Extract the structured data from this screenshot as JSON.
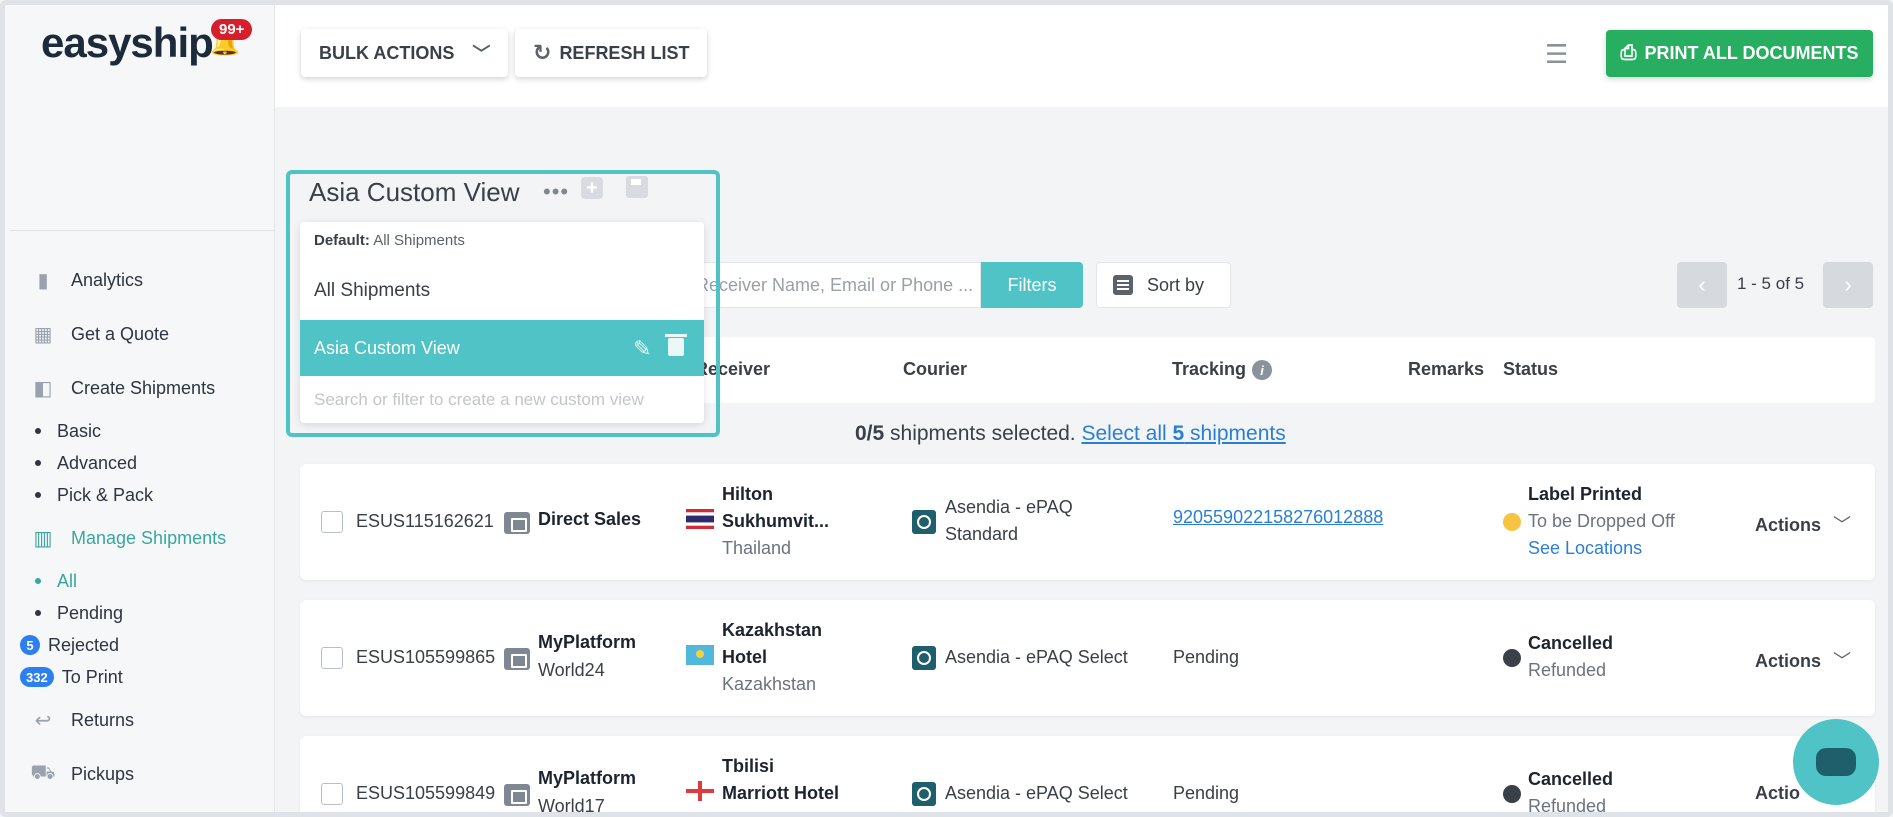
{
  "app": {
    "logo": "easyship",
    "notification_count": "99+"
  },
  "sidebar": {
    "items": [
      {
        "label": "Analytics",
        "icon": "analytics-icon"
      },
      {
        "label": "Get a Quote",
        "icon": "calculator-icon"
      },
      {
        "label": "Create Shipments",
        "icon": "box-icon"
      }
    ],
    "create_sub": [
      "Basic",
      "Advanced",
      "Pick & Pack"
    ],
    "manage": {
      "label": "Manage Shipments",
      "icon": "barcode-icon"
    },
    "manage_sub": [
      {
        "label": "All",
        "count": null,
        "active": true
      },
      {
        "label": "Pending",
        "count": null
      },
      {
        "label": "Rejected",
        "count": "5"
      },
      {
        "label": "To Print",
        "count": "332"
      }
    ],
    "bottom_items": [
      {
        "label": "Returns",
        "icon": "returns-icon"
      },
      {
        "label": "Pickups",
        "icon": "truck-icon"
      }
    ]
  },
  "toolbar": {
    "bulk_actions": "BULK ACTIONS",
    "refresh": "REFRESH LIST",
    "print_all": "PRINT ALL DOCUMENTS"
  },
  "custom_view": {
    "title": "Asia Custom View",
    "menu_dots": "•••",
    "add": "+",
    "dropdown": {
      "default_label": "Default:",
      "default_value": "All Shipments",
      "option_all": "All Shipments",
      "option_active": "Asia Custom View",
      "search_placeholder": "Search or filter to create a new custom view"
    }
  },
  "search": {
    "placeholder": "Receiver Name, Email or Phone ...",
    "filters": "Filters",
    "sort": "Sort by"
  },
  "pager": {
    "text": "1 - 5 of 5",
    "prev": "‹",
    "next": "›"
  },
  "table": {
    "headers": {
      "receiver": "Receiver",
      "courier": "Courier",
      "tracking": "Tracking",
      "remarks": "Remarks",
      "status": "Status"
    },
    "info": "i",
    "selected": {
      "count": "0/5",
      "text": " shipments selected. ",
      "select_all_prefix": "Select all ",
      "select_all_count": "5",
      "select_all_suffix": " shipments"
    },
    "rows": [
      {
        "id": "ESUS115162621",
        "store": "Direct Sales",
        "store_sub": "",
        "receiver_line1": "Hilton",
        "receiver_line2": "Sukhumvit...",
        "country": "Thailand",
        "courier_line1": "Asendia - ePAQ",
        "courier_line2": "Standard",
        "tracking": "920559022158276012888",
        "status_title": "Label Printed",
        "status_sub": "To be Dropped Off",
        "status_link": "See Locations",
        "status_color": "#f6c342",
        "actions": "Actions"
      },
      {
        "id": "ESUS105599865",
        "store": "MyPlatform",
        "store_sub": "World24",
        "receiver_line1": "Kazakhstan",
        "receiver_line2": "Hotel",
        "country": "Kazakhstan",
        "courier_line1": "Asendia - ePAQ Select",
        "courier_line2": "",
        "tracking": "Pending",
        "status_title": "Cancelled",
        "status_sub": "Refunded",
        "status_link": "",
        "status_color": "#3a4048",
        "actions": "Actions"
      },
      {
        "id": "ESUS105599849",
        "store": "MyPlatform",
        "store_sub": "World17",
        "receiver_line1": "Tbilisi",
        "receiver_line2": "Marriott Hotel",
        "country": "",
        "courier_line1": "Asendia - ePAQ Select",
        "courier_line2": "",
        "tracking": "Pending",
        "status_title": "Cancelled",
        "status_sub": "Refunded",
        "status_link": "",
        "status_color": "#3a4048",
        "actions": "Actio"
      }
    ]
  },
  "colors": {
    "accent": "#4fc3c5",
    "brand_green": "#27ae60",
    "link": "#2a7fd4",
    "badge_red": "#d61f2c"
  }
}
